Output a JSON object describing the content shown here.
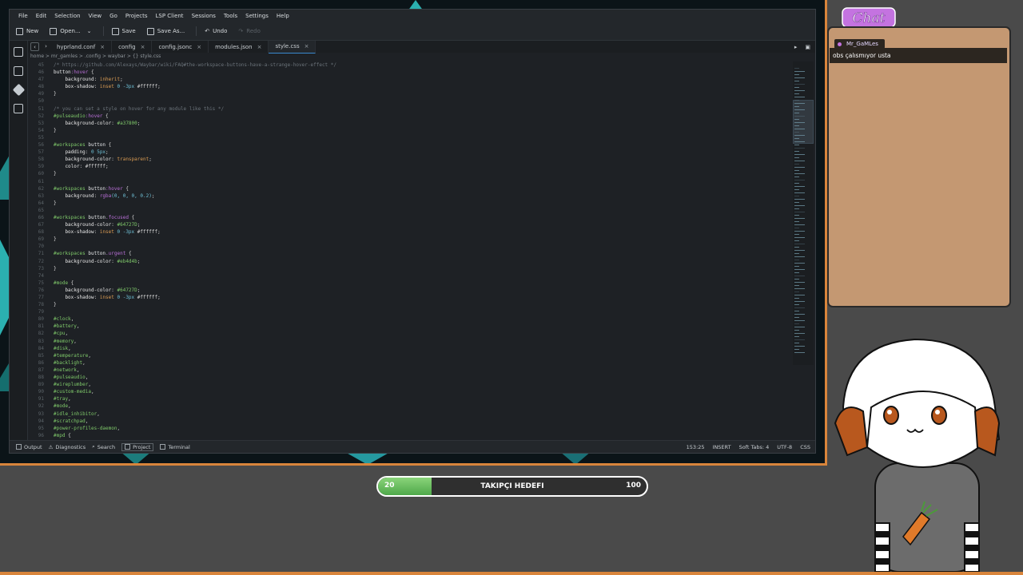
{
  "editor": {
    "menu": [
      "File",
      "Edit",
      "Selection",
      "View",
      "Go",
      "Projects",
      "LSP Client",
      "Sessions",
      "Tools",
      "Settings",
      "Help"
    ],
    "toolbar": {
      "new": "New",
      "open": "Open...",
      "save": "Save",
      "save_as": "Save As...",
      "undo": "Undo",
      "redo": "Redo"
    },
    "tabs": [
      {
        "label": "hyprland.conf"
      },
      {
        "label": "config"
      },
      {
        "label": "config.jsonc"
      },
      {
        "label": "modules.json"
      },
      {
        "label": "style.css"
      }
    ],
    "breadcrumb": "home  >  mr_gamles  >  .config  >  waybar  >  {} style.css",
    "status": {
      "output": "Output",
      "diagnostics": "Diagnostics",
      "search": "Search",
      "project": "Project",
      "terminal": "Terminal",
      "cursor": "153:25",
      "mode": "INSERT",
      "tabs": "Soft Tabs: 4",
      "encoding": "UTF-8",
      "syntax": "CSS"
    }
  },
  "code": [
    {
      "n": "45",
      "t": [
        [
          "cmt",
          "/* https://github.com/Alexays/Waybar/wiki/FAQ#the-workspace-buttons-have-a-strange-hover-effect */"
        ]
      ]
    },
    {
      "n": "46",
      "t": [
        [
          "sel",
          "button"
        ],
        [
          "kw",
          ":hover"
        ],
        [
          "val",
          " {"
        ]
      ]
    },
    {
      "n": "47",
      "t": [
        [
          "prop",
          "    background"
        ],
        [
          "val",
          ": "
        ],
        [
          "str",
          "inherit"
        ],
        [
          "val",
          ";"
        ]
      ]
    },
    {
      "n": "48",
      "t": [
        [
          "prop",
          "    box-shadow"
        ],
        [
          "val",
          ": "
        ],
        [
          "str",
          "inset"
        ],
        [
          "num",
          " 0 -3px"
        ],
        [
          "val",
          " #ffffff;"
        ]
      ]
    },
    {
      "n": "49",
      "t": [
        [
          "val",
          "}"
        ]
      ]
    },
    {
      "n": "50",
      "t": []
    },
    {
      "n": "51",
      "t": [
        [
          "cmt",
          "/* you can set a style on hover for any module like this */"
        ]
      ]
    },
    {
      "n": "52",
      "t": [
        [
          "id",
          "#pulseaudio"
        ],
        [
          "kw",
          ":hover"
        ],
        [
          "val",
          " {"
        ]
      ]
    },
    {
      "n": "53",
      "t": [
        [
          "prop",
          "    background-color"
        ],
        [
          "val",
          ": "
        ],
        [
          "id",
          "#a37800"
        ],
        [
          "val",
          ";"
        ]
      ]
    },
    {
      "n": "54",
      "t": [
        [
          "val",
          "}"
        ]
      ]
    },
    {
      "n": "55",
      "t": []
    },
    {
      "n": "56",
      "t": [
        [
          "id",
          "#workspaces"
        ],
        [
          "sel",
          " button"
        ],
        [
          "val",
          " {"
        ]
      ]
    },
    {
      "n": "57",
      "t": [
        [
          "prop",
          "    padding"
        ],
        [
          "val",
          ": "
        ],
        [
          "num",
          "0 5px"
        ],
        [
          "val",
          ";"
        ]
      ]
    },
    {
      "n": "58",
      "t": [
        [
          "prop",
          "    background-color"
        ],
        [
          "val",
          ": "
        ],
        [
          "str",
          "transparent"
        ],
        [
          "val",
          ";"
        ]
      ]
    },
    {
      "n": "59",
      "t": [
        [
          "prop",
          "    color"
        ],
        [
          "val",
          ": #ffffff;"
        ]
      ]
    },
    {
      "n": "60",
      "t": [
        [
          "val",
          "}"
        ]
      ]
    },
    {
      "n": "61",
      "t": []
    },
    {
      "n": "62",
      "t": [
        [
          "id",
          "#workspaces"
        ],
        [
          "sel",
          " button"
        ],
        [
          "kw",
          ":hover"
        ],
        [
          "val",
          " {"
        ]
      ]
    },
    {
      "n": "63",
      "t": [
        [
          "prop",
          "    background"
        ],
        [
          "val",
          ": "
        ],
        [
          "kw",
          "rgba"
        ],
        [
          "num",
          "(0, 0, 0, 0.2)"
        ],
        [
          "val",
          ";"
        ]
      ]
    },
    {
      "n": "64",
      "t": [
        [
          "val",
          "}"
        ]
      ]
    },
    {
      "n": "65",
      "t": []
    },
    {
      "n": "66",
      "t": [
        [
          "id",
          "#workspaces"
        ],
        [
          "sel",
          " button"
        ],
        [
          "kw",
          ".focused"
        ],
        [
          "val",
          " {"
        ]
      ]
    },
    {
      "n": "67",
      "t": [
        [
          "prop",
          "    background-color"
        ],
        [
          "val",
          ": "
        ],
        [
          "id",
          "#64727D"
        ],
        [
          "val",
          ";"
        ]
      ]
    },
    {
      "n": "68",
      "t": [
        [
          "prop",
          "    box-shadow"
        ],
        [
          "val",
          ": "
        ],
        [
          "str",
          "inset"
        ],
        [
          "num",
          " 0 -3px"
        ],
        [
          "val",
          " #ffffff;"
        ]
      ]
    },
    {
      "n": "69",
      "t": [
        [
          "val",
          "}"
        ]
      ]
    },
    {
      "n": "70",
      "t": []
    },
    {
      "n": "71",
      "t": [
        [
          "id",
          "#workspaces"
        ],
        [
          "sel",
          " button"
        ],
        [
          "kw",
          ".urgent"
        ],
        [
          "val",
          " {"
        ]
      ]
    },
    {
      "n": "72",
      "t": [
        [
          "prop",
          "    background-color"
        ],
        [
          "val",
          ": "
        ],
        [
          "id",
          "#eb4d4b"
        ],
        [
          "val",
          ";"
        ]
      ]
    },
    {
      "n": "73",
      "t": [
        [
          "val",
          "}"
        ]
      ]
    },
    {
      "n": "74",
      "t": []
    },
    {
      "n": "75",
      "t": [
        [
          "id",
          "#mode"
        ],
        [
          "val",
          " {"
        ]
      ]
    },
    {
      "n": "76",
      "t": [
        [
          "prop",
          "    background-color"
        ],
        [
          "val",
          ": "
        ],
        [
          "id",
          "#64727D"
        ],
        [
          "val",
          ";"
        ]
      ]
    },
    {
      "n": "77",
      "t": [
        [
          "prop",
          "    box-shadow"
        ],
        [
          "val",
          ": "
        ],
        [
          "str",
          "inset"
        ],
        [
          "num",
          " 0 -3px"
        ],
        [
          "val",
          " #ffffff;"
        ]
      ]
    },
    {
      "n": "78",
      "t": [
        [
          "val",
          "}"
        ]
      ]
    },
    {
      "n": "79",
      "t": []
    },
    {
      "n": "80",
      "t": [
        [
          "id",
          "#clock"
        ],
        [
          "val",
          ","
        ]
      ]
    },
    {
      "n": "81",
      "t": [
        [
          "id",
          "#battery"
        ],
        [
          "val",
          ","
        ]
      ]
    },
    {
      "n": "82",
      "t": [
        [
          "id",
          "#cpu"
        ],
        [
          "val",
          ","
        ]
      ]
    },
    {
      "n": "83",
      "t": [
        [
          "id",
          "#memory"
        ],
        [
          "val",
          ","
        ]
      ]
    },
    {
      "n": "84",
      "t": [
        [
          "id",
          "#disk"
        ],
        [
          "val",
          ","
        ]
      ]
    },
    {
      "n": "85",
      "t": [
        [
          "id",
          "#temperature"
        ],
        [
          "val",
          ","
        ]
      ]
    },
    {
      "n": "86",
      "t": [
        [
          "id",
          "#backlight"
        ],
        [
          "val",
          ","
        ]
      ]
    },
    {
      "n": "87",
      "t": [
        [
          "id",
          "#network"
        ],
        [
          "val",
          ","
        ]
      ]
    },
    {
      "n": "88",
      "t": [
        [
          "id",
          "#pulseaudio"
        ],
        [
          "val",
          ","
        ]
      ]
    },
    {
      "n": "89",
      "t": [
        [
          "id",
          "#wireplumber"
        ],
        [
          "val",
          ","
        ]
      ]
    },
    {
      "n": "90",
      "t": [
        [
          "id",
          "#custom-media"
        ],
        [
          "val",
          ","
        ]
      ]
    },
    {
      "n": "91",
      "t": [
        [
          "id",
          "#tray"
        ],
        [
          "val",
          ","
        ]
      ]
    },
    {
      "n": "92",
      "t": [
        [
          "id",
          "#mode"
        ],
        [
          "val",
          ","
        ]
      ]
    },
    {
      "n": "93",
      "t": [
        [
          "id",
          "#idle_inhibitor"
        ],
        [
          "val",
          ","
        ]
      ]
    },
    {
      "n": "94",
      "t": [
        [
          "id",
          "#scratchpad"
        ],
        [
          "val",
          ","
        ]
      ]
    },
    {
      "n": "95",
      "t": [
        [
          "id",
          "#power-profiles-daemon"
        ],
        [
          "val",
          ","
        ]
      ]
    },
    {
      "n": "96",
      "t": [
        [
          "id",
          "#mpd"
        ],
        [
          "val",
          " {"
        ]
      ]
    }
  ],
  "chat": {
    "logo_text": "Chat",
    "username": "Mr_GaMLes",
    "message": "obs çalısmıyor usta"
  },
  "goal": {
    "title": "TAKIPÇI HEDEFI",
    "current": "20",
    "max": "100",
    "progress": 0.2
  },
  "colors": {
    "accent_orange": "#d9853b",
    "chat_bg": "#c49872",
    "goal_green": "#5cb85a"
  }
}
